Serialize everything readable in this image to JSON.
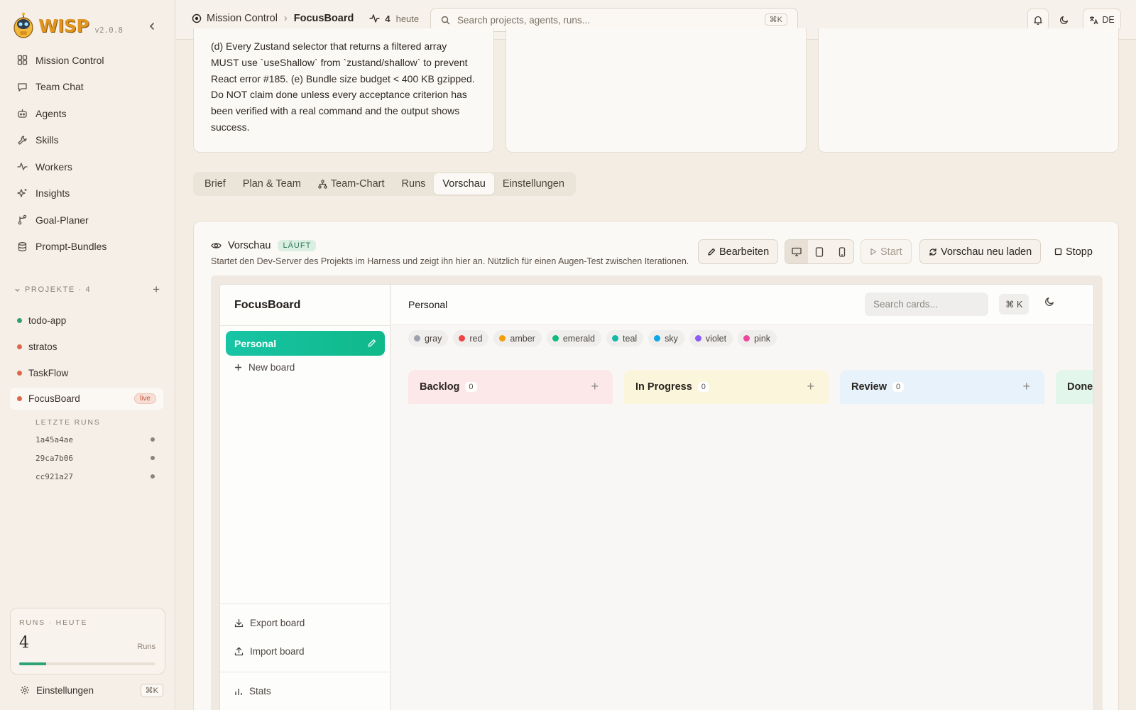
{
  "sidebar": {
    "brand": "WISP",
    "version": "v2.0.8",
    "nav": [
      {
        "label": "Mission Control",
        "icon": "grid-icon"
      },
      {
        "label": "Team Chat",
        "icon": "chat-icon"
      },
      {
        "label": "Agents",
        "icon": "robot-icon"
      },
      {
        "label": "Skills",
        "icon": "wrench-icon"
      },
      {
        "label": "Workers",
        "icon": "activity-icon"
      },
      {
        "label": "Insights",
        "icon": "sparkles-icon"
      },
      {
        "label": "Goal-Planer",
        "icon": "branch-icon"
      },
      {
        "label": "Prompt-Bundles",
        "icon": "database-icon"
      }
    ],
    "projects_header": "PROJEKTE · 4",
    "projects": [
      {
        "name": "todo-app",
        "color": "#2fa276"
      },
      {
        "name": "stratos",
        "color": "#e0674a"
      },
      {
        "name": "TaskFlow",
        "color": "#e0674a"
      },
      {
        "name": "FocusBoard",
        "color": "#e0674a",
        "badge": "live"
      }
    ],
    "recent_runs_label": "LETZTE RUNS",
    "recent_runs": [
      "1a45a4ae",
      "29ca7b06",
      "cc921a27"
    ],
    "runs_today": {
      "label": "RUNS · HEUTE",
      "count": "4",
      "unit": "Runs",
      "progress": 0.2
    },
    "settings": {
      "label": "Einstellungen",
      "shortcut": "⌘K"
    }
  },
  "topbar": {
    "breadcrumb_root": "Mission Control",
    "breadcrumb_current": "FocusBoard",
    "activity_count": "4",
    "activity_label": "heute",
    "search_placeholder": "Search projects, agents, runs...",
    "search_shortcut": "⌘K",
    "language": "DE"
  },
  "brief": {
    "text": "(d) Every Zustand selector that returns a filtered array MUST use `useShallow` from `zustand/shallow` to prevent React error #185. (e) Bundle size budget < 400 KB gzipped. Do NOT claim done unless every acceptance criterion has been verified with a real command and the output shows success."
  },
  "tabs": [
    {
      "label": "Brief"
    },
    {
      "label": "Plan & Team"
    },
    {
      "label": "Team-Chart"
    },
    {
      "label": "Runs"
    },
    {
      "label": "Vorschau",
      "active": true
    },
    {
      "label": "Einstellungen"
    }
  ],
  "preview": {
    "title": "Vorschau",
    "status": "LÄUFT",
    "description": "Startet den Dev-Server des Projekts im Harness und zeigt ihn hier an. Nützlich für einen Augen-Test zwischen Iterationen.",
    "edit_label": "Bearbeiten",
    "start_label": "Start",
    "reload_label": "Vorschau neu laden",
    "stop_label": "Stopp"
  },
  "app": {
    "title": "FocusBoard",
    "active_board": "Personal",
    "new_board": "New board",
    "export": "Export board",
    "import": "Import board",
    "stats": "Stats",
    "board_name": "Personal",
    "card_search_placeholder": "Search cards...",
    "shortcut": "⌘ K",
    "labels": [
      {
        "name": "gray",
        "color": "#9ca3af"
      },
      {
        "name": "red",
        "color": "#ef4444"
      },
      {
        "name": "amber",
        "color": "#f59e0b"
      },
      {
        "name": "emerald",
        "color": "#10b981"
      },
      {
        "name": "teal",
        "color": "#14b8a6"
      },
      {
        "name": "sky",
        "color": "#0ea5e9"
      },
      {
        "name": "violet",
        "color": "#8b5cf6"
      },
      {
        "name": "pink",
        "color": "#ec4899"
      }
    ],
    "columns": [
      {
        "name": "Backlog",
        "count": "0",
        "bg": "#fce8e8"
      },
      {
        "name": "In Progress",
        "count": "0",
        "bg": "#fbf5dc"
      },
      {
        "name": "Review",
        "count": "0",
        "bg": "#e7f2fb"
      },
      {
        "name": "Done",
        "count": "",
        "bg": "#e3f6ec"
      }
    ]
  }
}
